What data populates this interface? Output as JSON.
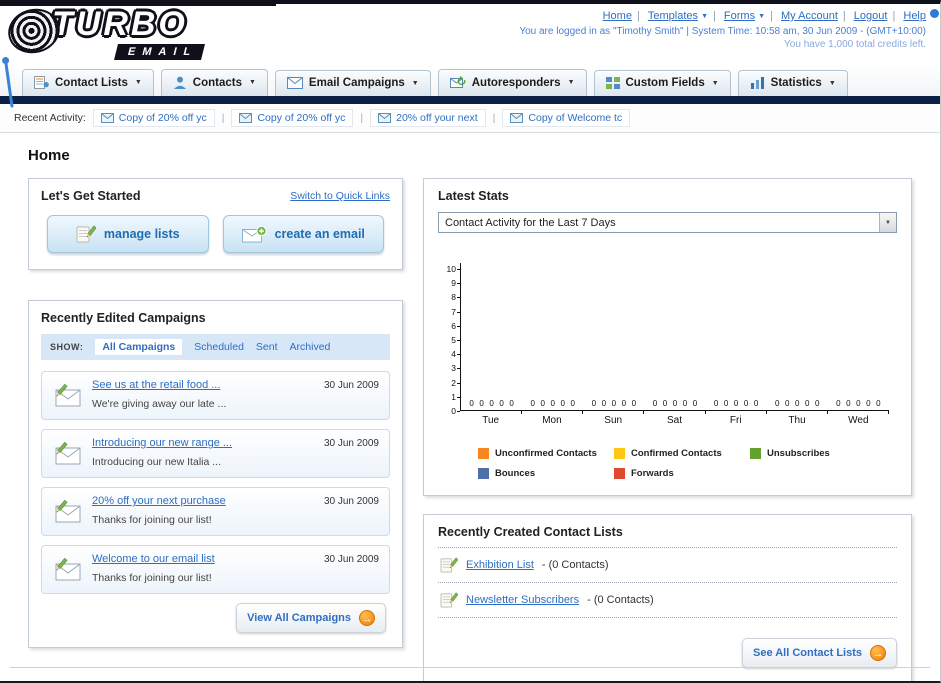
{
  "logo": {
    "title": "TURBO",
    "subtitle": "EMAIL"
  },
  "icons": {
    "caret_down": "▼",
    "arrow_right": "→"
  },
  "top_nav": {
    "links": [
      {
        "label": "Home"
      },
      {
        "label": "Templates"
      },
      {
        "label": "Forms"
      },
      {
        "label": "My Account"
      },
      {
        "label": "Logout"
      },
      {
        "label": "Help"
      }
    ],
    "login_info": "You are logged in as \"Timothy Smith\" | System Time: 10:58 am, 30 Jun 2009 - (GMT+10:00)",
    "credits_info": "You have 1,000 total credits left."
  },
  "main_tabs": [
    {
      "label": "Contact Lists"
    },
    {
      "label": "Contacts"
    },
    {
      "label": "Email Campaigns"
    },
    {
      "label": "Autoresponders"
    },
    {
      "label": "Custom Fields"
    },
    {
      "label": "Statistics"
    }
  ],
  "recent_activity": {
    "label": "Recent Activity:",
    "items": [
      "Copy of 20% off yc",
      "Copy of 20% off yc",
      "20% off your next",
      "Copy of Welcome tc"
    ]
  },
  "page": {
    "title": "Home"
  },
  "get_started": {
    "title": "Let's Get Started",
    "switch_link": "Switch to Quick Links",
    "manage_lists_label": "manage lists",
    "create_email_label": "create an email"
  },
  "campaigns": {
    "title": "Recently Edited Campaigns",
    "show_label": "SHOW:",
    "filters": [
      "All Campaigns",
      "Scheduled",
      "Sent",
      "Archived"
    ],
    "active_filter": "All Campaigns",
    "items": [
      {
        "title": "See us at the retail food ...",
        "subtitle": "We're giving away our late ...",
        "date": "30 Jun 2009"
      },
      {
        "title": "Introducing our new range ...",
        "subtitle": "Introducing our new Italia ...",
        "date": "30 Jun 2009"
      },
      {
        "title": "20% off your next purchase",
        "subtitle": "Thanks for joining our list!",
        "date": "30 Jun 2009"
      },
      {
        "title": "Welcome to our email list",
        "subtitle": "Thanks for joining our list!",
        "date": "30 Jun 2009"
      }
    ],
    "view_all_label": "View All Campaigns"
  },
  "stats": {
    "title": "Latest Stats",
    "period_selected": "Contact Activity for the Last 7 Days"
  },
  "chart_data": {
    "type": "bar",
    "title": "Contact Activity for the Last 7 Days",
    "categories": [
      "Tue",
      "Mon",
      "Sun",
      "Sat",
      "Fri",
      "Thu",
      "Wed"
    ],
    "series": [
      {
        "name": "Unconfirmed Contacts",
        "color": "#f6871f",
        "values": [
          0,
          0,
          0,
          0,
          0,
          0,
          0
        ]
      },
      {
        "name": "Confirmed Contacts",
        "color": "#fdc713",
        "values": [
          0,
          0,
          0,
          0,
          0,
          0,
          0
        ]
      },
      {
        "name": "Unsubscribes",
        "color": "#64a12d",
        "values": [
          0,
          0,
          0,
          0,
          0,
          0,
          0
        ]
      },
      {
        "name": "Bounces",
        "color": "#4f6fa8",
        "values": [
          0,
          0,
          0,
          0,
          0,
          0,
          0
        ]
      },
      {
        "name": "Forwards",
        "color": "#e0492e",
        "values": [
          0,
          0,
          0,
          0,
          0,
          0,
          0
        ]
      }
    ],
    "ylim": [
      0,
      10
    ],
    "ytick_step": 1,
    "value_labels_shown": true,
    "grid": false,
    "legend_position": "bottom"
  },
  "contact_lists": {
    "title": "Recently Created Contact Lists",
    "items": [
      {
        "name": "Exhibition List",
        "detail": "- (0 Contacts)"
      },
      {
        "name": "Newsletter Subscribers",
        "detail": "- (0 Contacts)"
      }
    ],
    "see_all_label": "See All Contact Lists"
  }
}
